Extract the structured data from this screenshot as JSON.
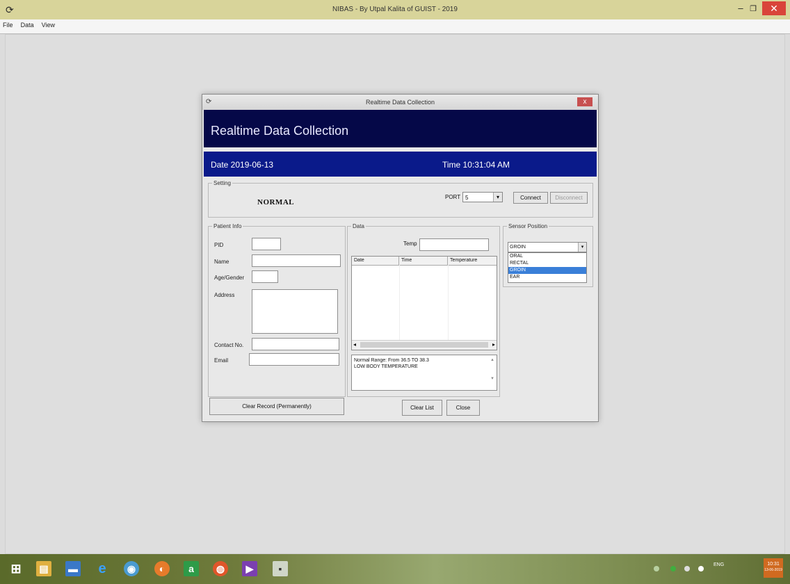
{
  "app": {
    "title": "NIBAS - By Utpal Kalita of GUIST - 2019",
    "icon": "app-logo-icon"
  },
  "menu": {
    "items": [
      "File",
      "Data",
      "View"
    ]
  },
  "dialog": {
    "title": "Realtime Data Collection",
    "close_label": "x",
    "header_title": "Realtime Data Collection",
    "date_text": "Date 2019-06-13",
    "time_text": "Time 10:31:04 AM",
    "setting": {
      "legend": "Setting",
      "status": "NORMAL",
      "port_label": "PORT",
      "port_value": "5",
      "connect_label": "Connect",
      "disconnect_label": "Disconnect"
    },
    "patient": {
      "legend": "Patient Info",
      "pid_label": "PID",
      "name_label": "Name",
      "age_gender_label": "Age/Gender",
      "address_label": "Address",
      "contact_label": "Contact No.",
      "email_label": "Email"
    },
    "data": {
      "legend": "Data",
      "time_label": "Temp",
      "columns": [
        "Date",
        "Time",
        "Temperature"
      ],
      "message_line1": "Normal Range: From 36.5 TO 38.3",
      "message_line2": "LOW BODY TEMPERATURE"
    },
    "sensor": {
      "legend": "Sensor Position",
      "selected": "GROIN",
      "options": [
        "ORAL",
        "RECTAL",
        "GROIN",
        "EAR"
      ],
      "highlighted_index": 2
    },
    "buttons": {
      "clear_record": "Clear Record (Permanently)",
      "clear_list": "Clear List",
      "close": "Close"
    }
  },
  "taskbar": {
    "icons": [
      "windows-start-icon",
      "file-explorer-icon",
      "desktop-icon",
      "internet-explorer-icon",
      "chrome-icon",
      "app-icon",
      "green-app-icon",
      "firefox-icon",
      "visual-studio-icon",
      "running-app-icon"
    ],
    "language": "ENG",
    "clock_time": "10:31",
    "clock_date": "13-06-2019"
  }
}
